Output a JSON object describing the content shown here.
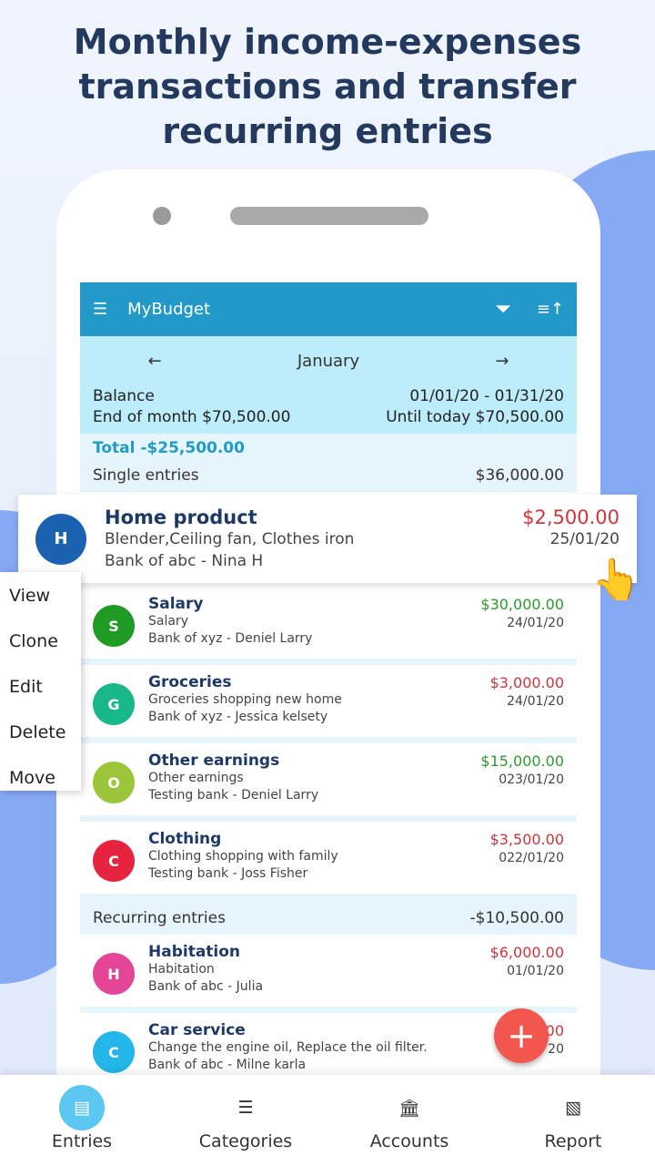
{
  "headline": "Monthly income-expenses transactions and transfer recurring entries",
  "appbar": {
    "title": "MyBudget",
    "menu_icon": "sort-lines-icon",
    "filter_icon": "filter-icon",
    "sort_icon": "sort-icon",
    "color": "#2399c9"
  },
  "month": {
    "label": "January",
    "prev": "←",
    "next": "→"
  },
  "balance": {
    "label": "Balance",
    "end_of_month": "End of month $70,500.00",
    "range": "01/01/20 - 01/31/20",
    "until_today": "Until today $70,500.00"
  },
  "total": "Total -$25,500.00",
  "single": {
    "label": "Single entries",
    "amount": "$36,000.00"
  },
  "highlight": {
    "initial": "H",
    "color": "#1b63b0",
    "title": "Home product",
    "desc": "Blender,Ceiling fan, Clothes iron",
    "account": "Bank of abc - Nina H",
    "amount": "$2,500.00",
    "date": "25/01/20"
  },
  "entries": [
    {
      "initial": "S",
      "color": "#1f9a23",
      "title": "Salary",
      "desc": "Salary",
      "account": "Bank of xyz - Deniel Larry",
      "amount": "$30,000.00",
      "date": "24/01/20",
      "type": "green"
    },
    {
      "initial": "G",
      "color": "#19b88a",
      "title": "Groceries",
      "desc": "Groceries shopping new home",
      "account": "Bank of xyz - Jessica kelsety",
      "amount": "$3,000.00",
      "date": "24/01/20",
      "type": "red"
    },
    {
      "initial": "O",
      "color": "#9cc63a",
      "title": "Other earnings",
      "desc": "Other earnings",
      "account": "Testing bank - Deniel Larry",
      "amount": "$15,000.00",
      "date": "023/01/20",
      "type": "green"
    },
    {
      "initial": "C",
      "color": "#e6243f",
      "title": "Clothing",
      "desc": "Clothing shopping with family",
      "account": "Testing bank - Joss Fisher",
      "amount": "$3,500.00",
      "date": "022/01/20",
      "type": "red"
    }
  ],
  "recurring": {
    "label": "Recurring entries",
    "amount": "-$10,500.00"
  },
  "recurring_entries": [
    {
      "initial": "H",
      "color": "#e54597",
      "title": "Habitation",
      "desc": "Habitation",
      "account": "Bank of abc - Julia",
      "amount": "$6,000.00",
      "date": "01/01/20",
      "type": "red"
    },
    {
      "initial": "C",
      "color": "#22b7e8",
      "title": "Car service",
      "desc": "Change the engine oil, Replace the oil filter.",
      "account": "Bank of abc - Milne karla",
      "amount": "$ 00",
      "date": "20",
      "type": "red"
    }
  ],
  "context_menu": [
    "View",
    "Clone",
    "Edit",
    "Delete",
    "Move"
  ],
  "fab": "+",
  "nav": [
    {
      "label": "Entries",
      "icon": "document-icon"
    },
    {
      "label": "Categories",
      "icon": "list-icon"
    },
    {
      "label": "Accounts",
      "icon": "bank-icon"
    },
    {
      "label": "Report",
      "icon": "report-icon"
    }
  ]
}
